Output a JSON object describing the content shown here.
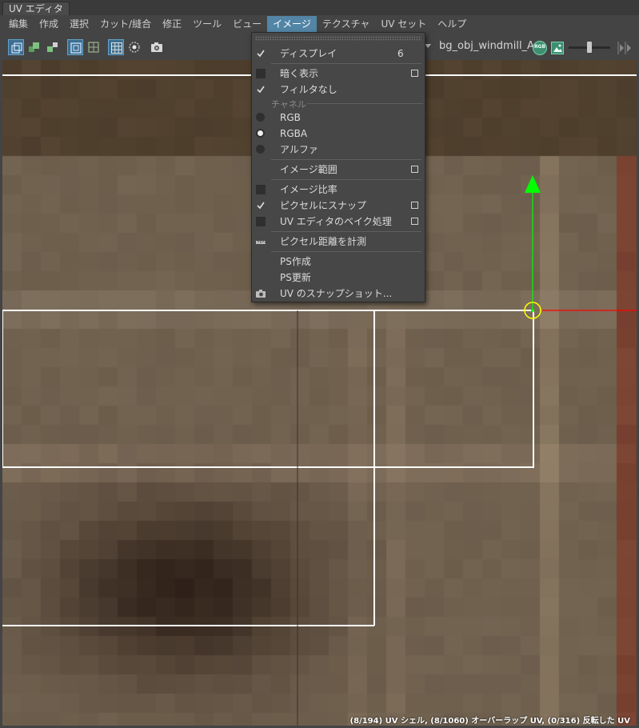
{
  "window": {
    "title": "UV エディタ"
  },
  "menubar": {
    "items": [
      {
        "label": "編集",
        "id": "edit"
      },
      {
        "label": "作成",
        "id": "create"
      },
      {
        "label": "選択",
        "id": "select"
      },
      {
        "label": "カット/縫合",
        "id": "cut-sew"
      },
      {
        "label": "修正",
        "id": "modify"
      },
      {
        "label": "ツール",
        "id": "tools"
      },
      {
        "label": "ビュー",
        "id": "view"
      },
      {
        "label": "イメージ",
        "id": "image"
      },
      {
        "label": "テクスチャ",
        "id": "textures"
      },
      {
        "label": "UV セット",
        "id": "uv-sets"
      },
      {
        "label": "ヘルプ",
        "id": "help"
      }
    ],
    "active": "image"
  },
  "toolbar": {
    "file_label": "bg_obj_windmill_A.",
    "rgb_badge": "RGB",
    "exposure_slider_fraction": 0.5
  },
  "image_menu": {
    "display": {
      "label": "ディスプレイ",
      "value": "6",
      "checked": true
    },
    "dim_image": {
      "label": "暗く表示",
      "checked": false
    },
    "no_filter": {
      "label": "フィルタなし",
      "checked": true
    },
    "channels_section": "チャネル",
    "rgb": {
      "label": "RGB",
      "selected": false
    },
    "rgba": {
      "label": "RGBA",
      "selected": true
    },
    "alpha": {
      "label": "アルファ",
      "selected": false
    },
    "image_range": {
      "label": "イメージ範囲"
    },
    "image_ratio": {
      "label": "イメージ比率",
      "checked": false
    },
    "snap_to_pixels": {
      "label": "ピクセルにスナップ",
      "checked": false
    },
    "uv_bake": {
      "label": "UV エディタのベイク処理",
      "checked": false
    },
    "measure_pixels": {
      "label": "ピクセル距離を計測"
    },
    "ps_create": {
      "label": "PS作成"
    },
    "ps_update": {
      "label": "PS更新"
    },
    "uv_snapshot": {
      "label": "UV のスナップショット..."
    }
  },
  "status_bar": {
    "text": "(8/194) UV シェル, (8/1060) オーバーラップ UV, (0/316) 反転した UV"
  },
  "colors": {
    "menu_highlight": "#5285a6",
    "manip_green": "#00ff00",
    "manip_red": "#ff0000",
    "manip_pivot": "#ffff00",
    "uv_edges": "#ffffff"
  }
}
